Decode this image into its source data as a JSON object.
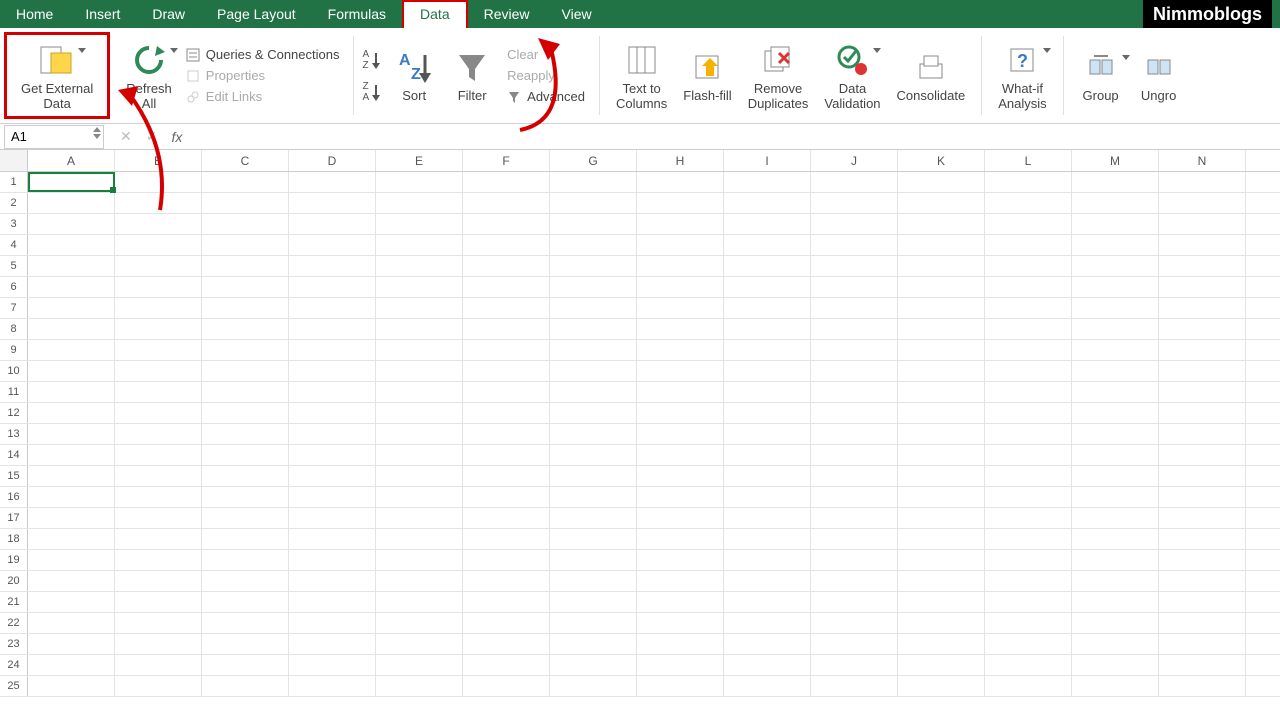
{
  "brand": "Nimmoblogs",
  "tabs": [
    "Home",
    "Insert",
    "Draw",
    "Page Layout",
    "Formulas",
    "Data",
    "Review",
    "View"
  ],
  "activeTab": "Data",
  "ribbon": {
    "getExternal": "Get External\nData",
    "refreshAll": "Refresh\nAll",
    "queries": "Queries & Connections",
    "properties": "Properties",
    "editLinks": "Edit Links",
    "sort": "Sort",
    "filter": "Filter",
    "clear": "Clear",
    "reapply": "Reapply",
    "advanced": "Advanced",
    "textToCols": "Text to\nColumns",
    "flashFill": "Flash-fill",
    "removeDup": "Remove\nDuplicates",
    "dataVal": "Data\nValidation",
    "consolidate": "Consolidate",
    "whatIf": "What-if\nAnalysis",
    "group": "Group",
    "ungroup": "Ungro"
  },
  "nameBox": "A1",
  "columns": [
    "A",
    "B",
    "C",
    "D",
    "E",
    "F",
    "G",
    "H",
    "I",
    "J",
    "K",
    "L",
    "M",
    "N"
  ],
  "rowCount": 25
}
